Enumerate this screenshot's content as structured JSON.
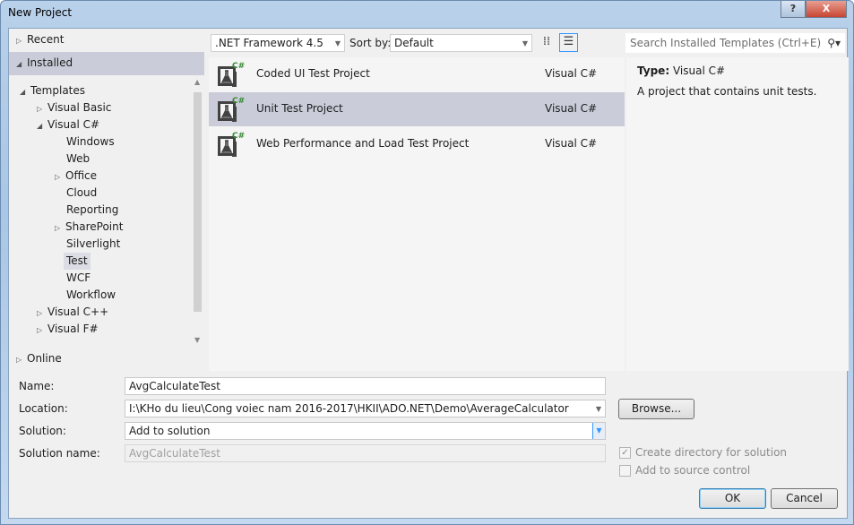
{
  "window": {
    "title": "New Project",
    "help": "?",
    "close": "X"
  },
  "tree": {
    "recent": "Recent",
    "installed": "Installed",
    "templates": "Templates",
    "items": [
      "Visual Basic",
      "Visual C#",
      "Windows",
      "Web",
      "Office",
      "Cloud",
      "Reporting",
      "SharePoint",
      "Silverlight",
      "Test",
      "WCF",
      "Workflow",
      "Visual C++",
      "Visual F#"
    ],
    "online": "Online"
  },
  "toolbar": {
    "framework": ".NET Framework 4.5",
    "sort_label": "Sort by:",
    "sort_value": "Default",
    "search_placeholder": "Search Installed Templates (Ctrl+E)"
  },
  "templates": [
    {
      "name": "Coded UI Test Project",
      "lang": "Visual C#"
    },
    {
      "name": "Unit Test Project",
      "lang": "Visual C#"
    },
    {
      "name": "Web Performance and Load Test Project",
      "lang": "Visual C#"
    }
  ],
  "details": {
    "type_label": "Type:",
    "type_value": "Visual C#",
    "description": "A project that contains unit tests."
  },
  "form": {
    "name_label": "Name:",
    "name_value": "AvgCalculateTest",
    "location_label": "Location:",
    "location_value": "I:\\KHo du lieu\\Cong voiec nam 2016-2017\\HKII\\ADO.NET\\Demo\\AverageCalculator",
    "solution_label": "Solution:",
    "solution_value": "Add to solution",
    "solution_name_label": "Solution name:",
    "solution_name_value": "AvgCalculateTest",
    "browse": "Browse...",
    "create_dir": "Create directory for solution",
    "source_control": "Add to source control",
    "ok": "OK",
    "cancel": "Cancel"
  },
  "colors": {
    "selected": "#cacdd9",
    "csharp": "#388a34"
  }
}
